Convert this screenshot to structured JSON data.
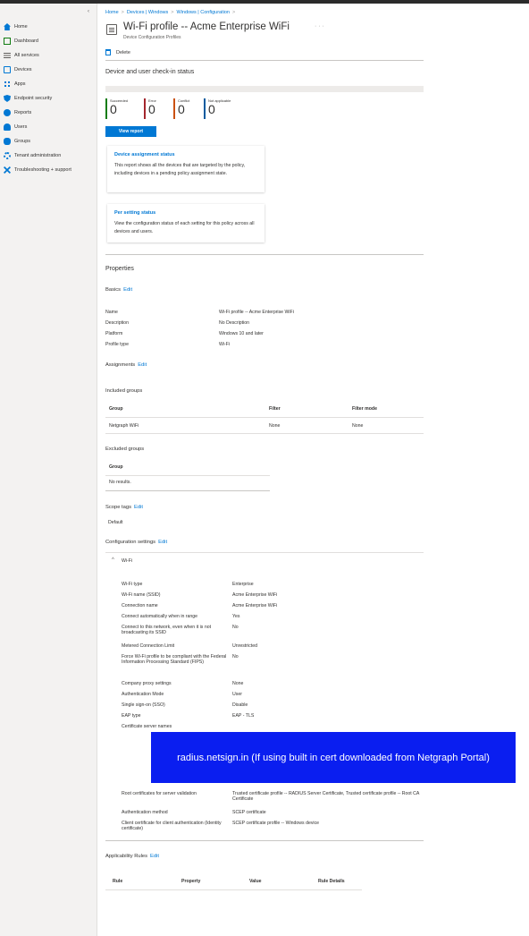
{
  "sidebar": {
    "collapse_glyph": "‹",
    "items": [
      {
        "label": "Home",
        "icon": "home-icon",
        "color": "#0078d4"
      },
      {
        "label": "Dashboard",
        "icon": "dashboard-icon",
        "color": "#107c10"
      },
      {
        "label": "All services",
        "icon": "list-icon",
        "color": "#605e5c"
      },
      {
        "label": "Devices",
        "icon": "devices-icon",
        "color": "#0078d4"
      },
      {
        "label": "Apps",
        "icon": "apps-icon",
        "color": "#0078d4"
      },
      {
        "label": "Endpoint security",
        "icon": "shield-icon",
        "color": "#0078d4"
      },
      {
        "label": "Reports",
        "icon": "reports-icon",
        "color": "#0078d4"
      },
      {
        "label": "Users",
        "icon": "user-icon",
        "color": "#0078d4"
      },
      {
        "label": "Groups",
        "icon": "groups-icon",
        "color": "#0078d4"
      },
      {
        "label": "Tenant administration",
        "icon": "tenant-icon",
        "color": "#0078d4"
      },
      {
        "label": "Troubleshooting + support",
        "icon": "wrench-icon",
        "color": "#0078d4"
      }
    ]
  },
  "breadcrumb": {
    "home": "Home",
    "devices": "Devices | Windows",
    "config": "Windows | Configuration",
    "sep": ">"
  },
  "header": {
    "title": "Wi-Fi profile -- Acme Enterprise WiFi",
    "more": "· · ·",
    "subtitle": "Device Configuration Profiles"
  },
  "toolbar": {
    "delete_label": "Delete"
  },
  "checkin": {
    "heading": "Device and user check-in status",
    "stats": [
      {
        "label": "Succeeded",
        "value": "0",
        "color": "#107c10"
      },
      {
        "label": "Error",
        "value": "0",
        "color": "#a4262c"
      },
      {
        "label": "Conflict",
        "value": "0",
        "color": "#ca5010"
      },
      {
        "label": "Not applicable",
        "value": "0",
        "color": "#005a9e"
      }
    ],
    "view_report": "View report"
  },
  "cards": [
    {
      "title": "Device assignment status",
      "desc": "This report shows all the devices that are targeted by the policy, including devices in a pending policy assignment state."
    },
    {
      "title": "Per setting status",
      "desc": "View the configuration status of each setting for this policy across all devices and users."
    }
  ],
  "properties": {
    "heading": "Properties",
    "basics": "Basics",
    "edit": "Edit",
    "rows": [
      {
        "k": "Name",
        "v": "Wi-Fi profile -- Acme Enterprise WiFi"
      },
      {
        "k": "Description",
        "v": "No Description"
      },
      {
        "k": "Platform",
        "v": "Windows 10 and later"
      },
      {
        "k": "Profile type",
        "v": "Wi-Fi"
      }
    ]
  },
  "assignments": {
    "heading": "Assignments",
    "included": "Included groups",
    "headers": [
      "Group",
      "Filter",
      "Filter mode"
    ],
    "row": [
      "Netgraph WiFi",
      "None",
      "None"
    ],
    "excluded": "Excluded groups",
    "excluded_header": "Group",
    "excluded_row": "No results."
  },
  "scope": {
    "heading": "Scope tags",
    "value": "Default"
  },
  "config": {
    "heading": "Configuration settings",
    "section": "Wi-Fi",
    "rows": [
      {
        "k": "Wi-Fi type",
        "v": "Enterprise"
      },
      {
        "k": "Wi-Fi name (SSID)",
        "v": "Acme Enterprise WiFi"
      },
      {
        "k": "Connection name",
        "v": "Acme Enterprise WiFi"
      },
      {
        "k": "Connect automatically when in range",
        "v": "Yes"
      },
      {
        "k": "Connect to this network, even when it is not broadcasting its SSID",
        "v": "No"
      },
      {
        "k": "Metered Connection Limit",
        "v": "Unrestricted"
      },
      {
        "k": "Force Wi-Fi profile to be compliant with the Federal Information Processing Standard (FIPS)",
        "v": "No"
      },
      {
        "k": "Company proxy settings",
        "v": "None"
      },
      {
        "k": "Authentication Mode",
        "v": "User"
      },
      {
        "k": "Single sign-on (SSO)",
        "v": "Disable"
      },
      {
        "k": "EAP type",
        "v": "EAP - TLS"
      },
      {
        "k": "Certificate server names",
        "v": ""
      },
      {
        "k": "Root certificates for server validation",
        "v": "Trusted certificate profile -- RADIUS Server Certificate, Trusted certificate profile -- Root CA Certificate"
      },
      {
        "k": "Authentication method",
        "v": "SCEP certificate"
      },
      {
        "k": "Client certificate for client authentication (Identity certificate)",
        "v": "SCEP certificate profile -- Windows device"
      }
    ],
    "overlay": "radius.netsign.in (If using built in cert downloaded from Netgraph Portal)"
  },
  "applicability": {
    "heading": "Applicability Rules",
    "headers": [
      "Rule",
      "Property",
      "Value",
      "Rule Details"
    ]
  }
}
